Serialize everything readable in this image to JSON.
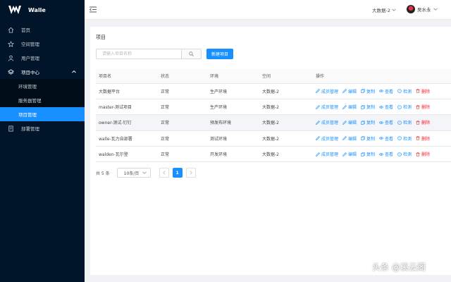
{
  "app": {
    "name": "Walle"
  },
  "sidebar": {
    "items": [
      {
        "label": "首页",
        "icon": "home-icon"
      },
      {
        "label": "空间管理",
        "icon": "star-icon"
      },
      {
        "label": "用户管理",
        "icon": "user-icon"
      },
      {
        "label": "项目中心",
        "icon": "layers-icon",
        "open": true
      },
      {
        "label": "部署管理",
        "icon": "deploy-icon"
      }
    ],
    "submenu": [
      {
        "label": "环境管理"
      },
      {
        "label": "服务器管理"
      },
      {
        "label": "项目管理",
        "active": true
      }
    ]
  },
  "header": {
    "space": "大数据-2",
    "user": "吴水永"
  },
  "page": {
    "title": "项目"
  },
  "search": {
    "placeholder": "请输入项目名称"
  },
  "toolbar": {
    "new_label": "新建项目"
  },
  "table": {
    "columns": [
      "项目名",
      "状态",
      "环境",
      "空间",
      "操作"
    ],
    "rows": [
      {
        "name": "大数据平台",
        "status": "正常",
        "env": "生产环境",
        "space": "大数据-2"
      },
      {
        "name": "master-测试项目",
        "status": "正常",
        "env": "生产环境",
        "space": "大数据-2"
      },
      {
        "name": "owner-测试-钉钉",
        "status": "正常",
        "env": "预发布环境",
        "space": "大数据-2"
      },
      {
        "name": "walle-瓦力自部署",
        "status": "正常",
        "env": "测试环境",
        "space": "大数据-2"
      },
      {
        "name": "walden-瓦尔登",
        "status": "正常",
        "env": "开发环境",
        "space": "大数据-2"
      }
    ],
    "actions": [
      "成员管理",
      "编辑",
      "复制",
      "查看",
      "检测",
      "删除"
    ]
  },
  "pagination": {
    "total": "共 5 条",
    "page_size": "10条/页",
    "current": "1"
  },
  "watermark": "头条 @溪云阁",
  "colors": {
    "sidebar": "#001529",
    "primary": "#1890ff",
    "danger": "#f5222d"
  }
}
